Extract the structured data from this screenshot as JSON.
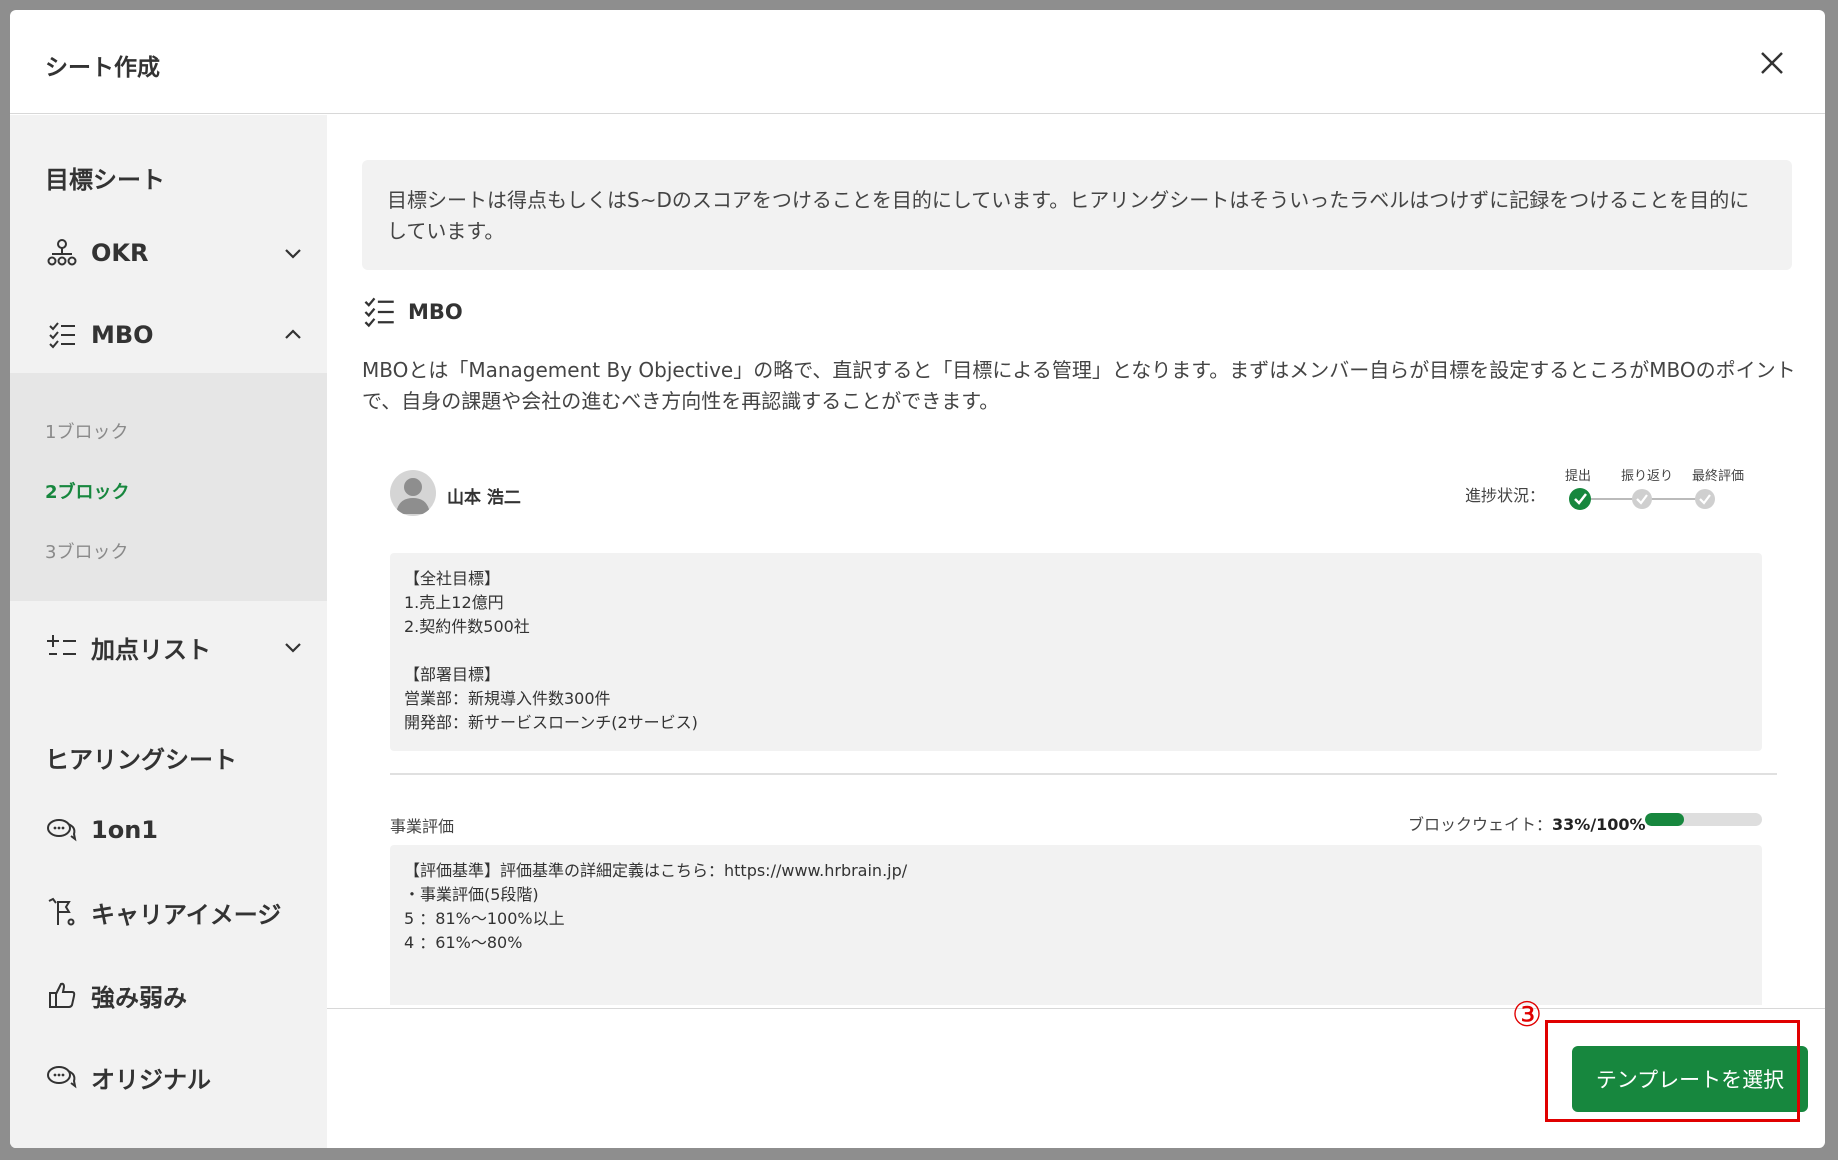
{
  "modal": {
    "title": "シート作成",
    "close_icon": "close-icon"
  },
  "sidebar": {
    "goal_section_title": "目標シート",
    "okr_label": "OKR",
    "mbo_label": "MBO",
    "mbo_sub_items": [
      "1ブロック",
      "2ブロック",
      "3ブロック"
    ],
    "mbo_active_index": 1,
    "bonus_label": "加点リスト",
    "hearing_section_title": "ヒアリングシート",
    "hearing_items": [
      "1on1",
      "キャリアイメージ",
      "強み弱み",
      "オリジナル"
    ]
  },
  "content": {
    "info_text": "目標シートは得点もしくはS~Dのスコアをつけることを目的にしています。ヒアリングシートはそういったラベルはつけずに記録をつけることを目的にしています。",
    "mbo_heading": "MBO",
    "mbo_description": "MBOとは「Management By Objective」の略で、直訳すると「目標による管理」となります。まずはメンバー自らが目標を設定するところがMBOのポイントで、自身の課題や会社の進むべき方向性を再認識することができます。",
    "preview": {
      "user_name": "山本 浩二",
      "progress_label": "進捗状況：",
      "steps": [
        {
          "label": "提出",
          "done": true
        },
        {
          "label": "振り返り",
          "done": false
        },
        {
          "label": "最終評価",
          "done": false
        }
      ],
      "goals_text": "【全社目標】\n 1.売上12億円\n 2.契約件数500社\n\n【部署目標】\n営業部：新規導入件数300件\n開発部：新サービスローンチ(2サービス)",
      "eval_label": "事業評価",
      "weight_prefix": "ブロックウェイト：",
      "weight_value": "33%/100%",
      "weight_fraction": 0.33,
      "criteria_text": "【評価基準】評価基準の詳細定義はこちら：https://www.hrbrain.jp/\n・事業評価(5段階)\n5 ：81%～100%以上\n4 ：61%～80%"
    }
  },
  "footer": {
    "select_button": "テンプレートを選択",
    "step_marker": "③"
  },
  "colors": {
    "accent": "#17873e",
    "highlight": "#e00000"
  }
}
